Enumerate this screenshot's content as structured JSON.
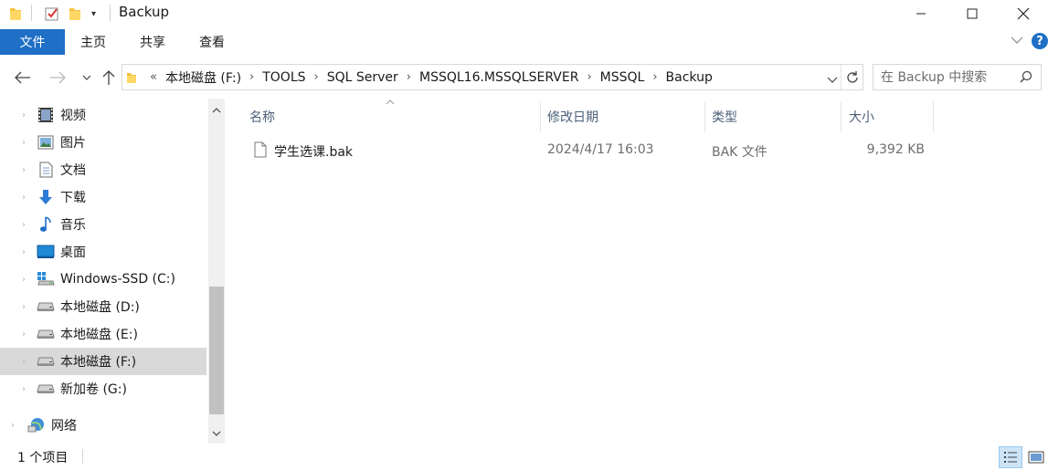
{
  "window": {
    "title": "Backup",
    "minimize_label": "",
    "colors": {
      "accent": "#1e6fc5",
      "selection": "#d9d9d9",
      "header_text": "#4c607a"
    }
  },
  "ribbon": {
    "tabs": [
      {
        "label": "文件",
        "active": true
      },
      {
        "label": "主页"
      },
      {
        "label": "共享"
      },
      {
        "label": "查看"
      }
    ]
  },
  "address": {
    "overflow": "«",
    "crumbs": [
      "本地磁盘 (F:)",
      "TOOLS",
      "SQL Server",
      "MSSQL16.MSSQLSERVER",
      "MSSQL",
      "Backup"
    ]
  },
  "search": {
    "placeholder": "在 Backup 中搜索"
  },
  "sidebar": {
    "items": [
      {
        "label": "视频",
        "icon": "video-icon"
      },
      {
        "label": "图片",
        "icon": "pictures-icon"
      },
      {
        "label": "文档",
        "icon": "documents-icon"
      },
      {
        "label": "下载",
        "icon": "download-icon"
      },
      {
        "label": "音乐",
        "icon": "music-icon"
      },
      {
        "label": "桌面",
        "icon": "desktop-icon"
      },
      {
        "label": "Windows-SSD (C:)",
        "icon": "system-drive-icon"
      },
      {
        "label": "本地磁盘 (D:)",
        "icon": "drive-icon"
      },
      {
        "label": "本地磁盘 (E:)",
        "icon": "drive-icon"
      },
      {
        "label": "本地磁盘 (F:)",
        "icon": "drive-icon",
        "selected": true
      },
      {
        "label": "新加卷 (G:)",
        "icon": "drive-icon"
      },
      {
        "label": "网络",
        "icon": "network-icon"
      }
    ]
  },
  "list": {
    "columns": {
      "name": "名称",
      "modified": "修改日期",
      "type": "类型",
      "size": "大小"
    },
    "files": [
      {
        "name": "学生选课.bak",
        "modified": "2024/4/17 16:03",
        "type": "BAK 文件",
        "size": "9,392 KB",
        "icon": "file-icon"
      }
    ]
  },
  "status": {
    "count": "1 个项目"
  }
}
